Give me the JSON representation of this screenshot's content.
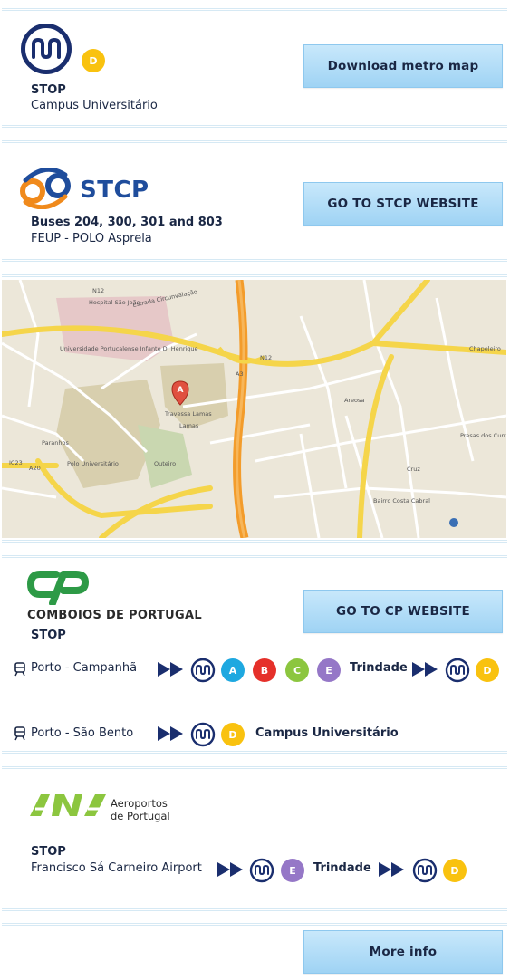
{
  "metro": {
    "line": "D",
    "stop_label": "STOP",
    "stop_name": "Campus Universitário",
    "button": "Download metro map"
  },
  "stcp": {
    "logo_text": "STCP",
    "buses": "Buses 204, 300, 301 and 803",
    "stop_name": "FEUP - POLO Asprela",
    "button": "GO TO STCP WEBSITE"
  },
  "map": {
    "labels": {
      "hospital": "Hospital São João",
      "universidade": "Universidade Portucalense Infante D. Henrique",
      "estrada": "Estrada Circunvalação",
      "travessa": "Travessa Lamas",
      "lamas": "Lamas",
      "areosa": "Areosa",
      "paranhos": "Paranhos",
      "polo": "Polo Universitário",
      "outeiro": "Outeiro",
      "chapeleiro": "Chapeleiro",
      "presas": "Presas dos Currais",
      "bairro": "Bairro Costa Cabral",
      "cruz": "Cruz",
      "n12a": "N12",
      "n12b": "N12",
      "a3": "A3",
      "a20": "A20",
      "ic23": "IC23",
      "marker": "A"
    }
  },
  "cp": {
    "brand": "COMBOIOS DE PORTUGAL",
    "stop_label": "STOP",
    "button": "GO TO CP WEBSITE",
    "route1": {
      "from": "Porto - Campanhã",
      "lines": [
        "A",
        "B",
        "C",
        "E"
      ],
      "transfer": "Trindade",
      "dest_line": "D"
    },
    "route2": {
      "from": "Porto - São Bento",
      "line": "D",
      "dest": "Campus Universitário"
    }
  },
  "ana": {
    "brand_line1": "Aeroportos",
    "brand_line2": "de Portugal",
    "stop_label": "STOP",
    "stop_name": "Francisco Sá Carneiro Airport",
    "line": "E",
    "transfer": "Trindade",
    "dest_line": "D"
  },
  "footer": {
    "button": "More info"
  },
  "colors": {
    "line_A": "#1ea8e0",
    "line_B": "#e5302a",
    "line_C": "#8cc63f",
    "line_D": "#f9c20f",
    "line_E": "#9577c7",
    "metro_navy": "#1a2e6e",
    "cp_green": "#2d9a46",
    "stcp_orange": "#f08a1c",
    "stcp_blue": "#1f4d9c",
    "ana_green": "#8cc63f"
  }
}
